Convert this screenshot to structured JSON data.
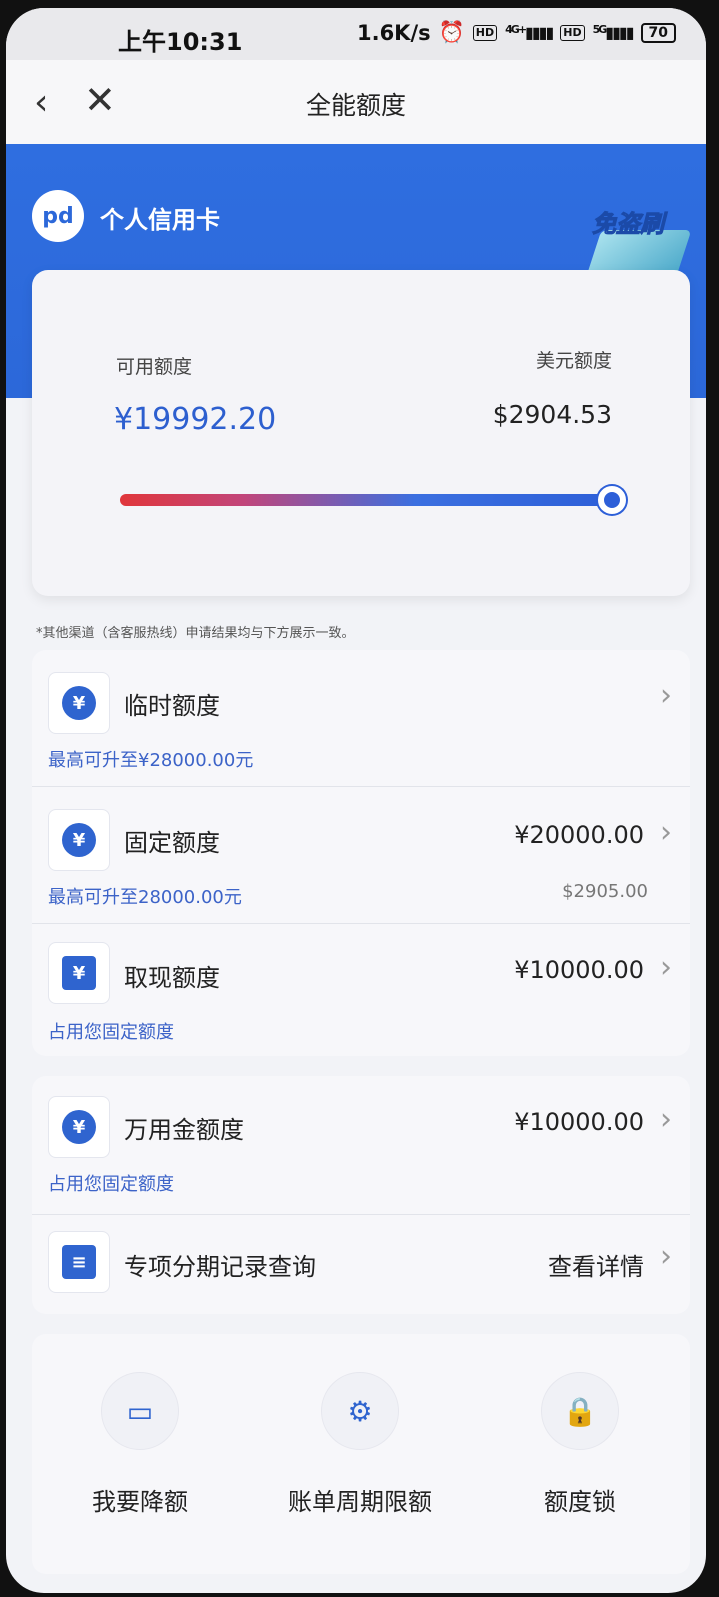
{
  "status_bar": {
    "time": "上午10:31",
    "network_speed": "1.6K/s",
    "hd1": "HD",
    "sig1": "4G+",
    "hd2": "HD",
    "sig2": "5G",
    "battery": "70"
  },
  "nav": {
    "back_icon": "chevron-left-icon",
    "close_icon": "close-icon",
    "title": "全能额度"
  },
  "header": {
    "card_name": "个人信用卡",
    "badge_text": "免盗刷",
    "logo_glyph": "pd"
  },
  "credit": {
    "available_label": "可用额度",
    "available_value": "¥19992.20",
    "usd_label": "美元额度",
    "usd_value": "$2904.53",
    "available_fraction": 1.0
  },
  "note": "*其他渠道（含客服热线）申请结果均与下方展示一致。",
  "limits": [
    {
      "icon": "yen-hand-icon",
      "glyph": "¥",
      "title": "临时额度",
      "value": "",
      "sub": "最高可升至¥28000.00元",
      "sub_right": ""
    },
    {
      "icon": "yen-refresh-icon",
      "glyph": "¥",
      "title": "固定额度",
      "value": "¥20000.00",
      "sub": "最高可升至28000.00元",
      "sub_right": "$2905.00"
    },
    {
      "icon": "cash-note-icon",
      "glyph": "¥",
      "title": "取现额度",
      "value": "¥10000.00",
      "sub": "占用您固定额度",
      "sub_right": ""
    }
  ],
  "extra": [
    {
      "icon": "money-bag-icon",
      "glyph": "¥",
      "title": "万用金额度",
      "value": "¥10000.00",
      "sub": "占用您固定额度"
    },
    {
      "icon": "document-list-icon",
      "glyph": "≡",
      "title": "专项分期记录查询",
      "value": "查看详情"
    }
  ],
  "actions": [
    {
      "icon": "wallet-icon",
      "glyph": "▭",
      "label": "我要降额"
    },
    {
      "icon": "gear-icon",
      "glyph": "⚙",
      "label": "账单周期限额"
    },
    {
      "icon": "lock-icon",
      "glyph": "🔒",
      "label": "额度锁"
    }
  ]
}
